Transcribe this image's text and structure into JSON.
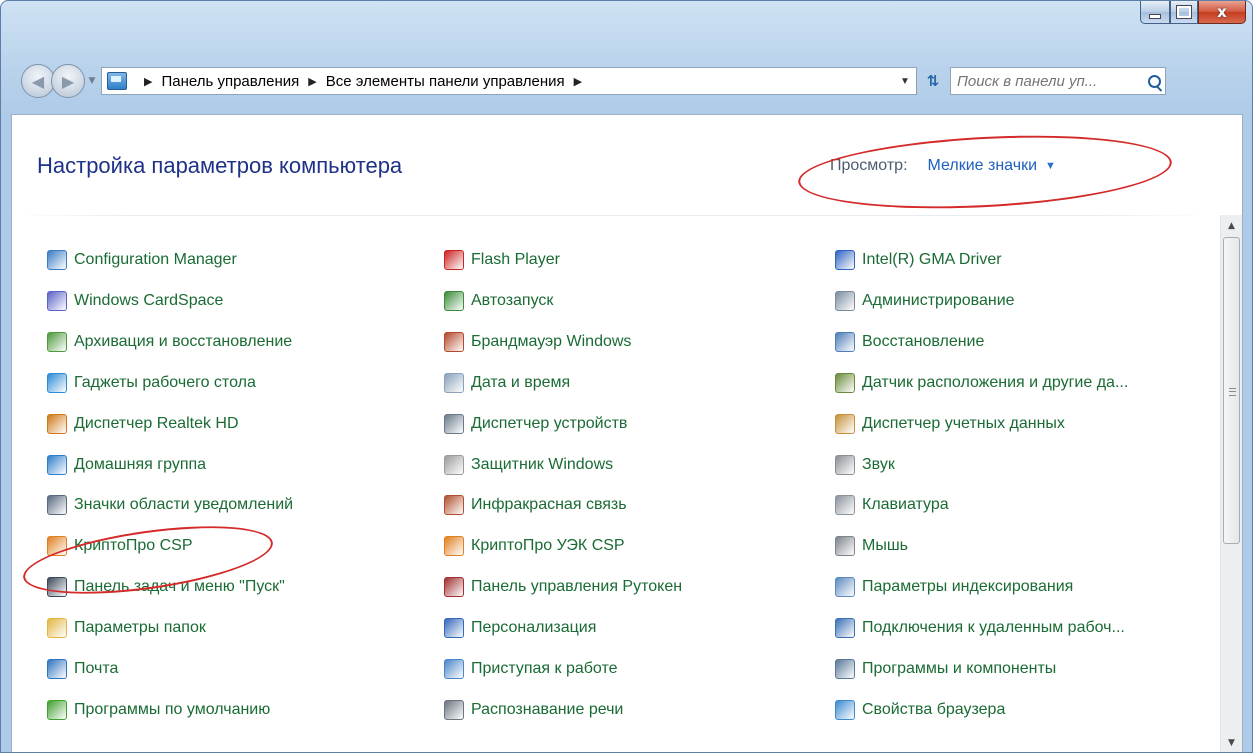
{
  "window": {
    "minimize_label": "",
    "maximize_label": "",
    "close_label": "x"
  },
  "nav": {
    "back_icon": "back-arrow-icon",
    "forward_icon": "forward-arrow-icon",
    "breadcrumb": [
      "Панель управления",
      "Все элементы панели управления"
    ],
    "search_placeholder": "Поиск в панели уп..."
  },
  "main": {
    "heading": "Настройка параметров компьютера",
    "view_label": "Просмотр:",
    "view_value": "Мелкие значки"
  },
  "items": [
    [
      {
        "label": "Configuration Manager",
        "icon": "configuration-manager-icon",
        "color": "#3a7dc4"
      },
      {
        "label": "Windows CardSpace",
        "icon": "cardspace-icon",
        "color": "#5a62c8"
      },
      {
        "label": "Архивация и восстановление",
        "icon": "backup-icon",
        "color": "#4f9a3d"
      },
      {
        "label": "Гаджеты рабочего стола",
        "icon": "gadgets-icon",
        "color": "#2b8bd6"
      },
      {
        "label": "Диспетчер Realtek HD",
        "icon": "realtek-icon",
        "color": "#d07a18"
      },
      {
        "label": "Домашняя группа",
        "icon": "homegroup-icon",
        "color": "#2e7ecb"
      },
      {
        "label": "Значки области уведомлений",
        "icon": "notification-icons-icon",
        "color": "#586a80"
      },
      {
        "label": "КриптоПро CSP",
        "icon": "cryptopro-icon",
        "color": "#e08020"
      },
      {
        "label": "Панель задач и меню \"Пуск\"",
        "icon": "taskbar-icon",
        "color": "#3d4a5c"
      },
      {
        "label": "Параметры папок",
        "icon": "folder-options-icon",
        "color": "#e2b640"
      },
      {
        "label": "Почта",
        "icon": "mail-icon",
        "color": "#2f74c0"
      },
      {
        "label": "Программы по умолчанию",
        "icon": "default-programs-icon",
        "color": "#41a02f"
      }
    ],
    [
      {
        "label": "Flash Player",
        "icon": "flash-player-icon",
        "color": "#cc2222"
      },
      {
        "label": "Автозапуск",
        "icon": "autoplay-icon",
        "color": "#3a8a3a"
      },
      {
        "label": "Брандмауэр Windows",
        "icon": "firewall-icon",
        "color": "#b24a2a"
      },
      {
        "label": "Дата и время",
        "icon": "clock-icon",
        "color": "#8aa0bb"
      },
      {
        "label": "Диспетчер устройств",
        "icon": "device-manager-icon",
        "color": "#6a7a8c"
      },
      {
        "label": "Защитник Windows",
        "icon": "defender-icon",
        "color": "#9b9b9b"
      },
      {
        "label": "Инфракрасная связь",
        "icon": "infrared-icon",
        "color": "#b05030"
      },
      {
        "label": "КриптоПро УЭК CSP",
        "icon": "cryptopro-uek-icon",
        "color": "#e08020"
      },
      {
        "label": "Панель управления Рутокен",
        "icon": "rutoken-icon",
        "color": "#a03030"
      },
      {
        "label": "Персонализация",
        "icon": "personalization-icon",
        "color": "#3468b8"
      },
      {
        "label": "Приступая к работе",
        "icon": "getting-started-icon",
        "color": "#4a86c8"
      },
      {
        "label": "Распознавание речи",
        "icon": "microphone-icon",
        "color": "#6b7480"
      }
    ],
    [
      {
        "label": "Intel(R) GMA Driver",
        "icon": "intel-gma-icon",
        "color": "#2f63c2"
      },
      {
        "label": "Администрирование",
        "icon": "administration-icon",
        "color": "#7a8c9e"
      },
      {
        "label": "Восстановление",
        "icon": "recovery-icon",
        "color": "#4c7db8"
      },
      {
        "label": "Датчик расположения и другие да...",
        "icon": "location-sensor-icon",
        "color": "#6b8b3a"
      },
      {
        "label": "Диспетчер учетных данных",
        "icon": "credential-manager-icon",
        "color": "#c6913a"
      },
      {
        "label": "Звук",
        "icon": "speaker-icon",
        "color": "#8a8f96"
      },
      {
        "label": "Клавиатура",
        "icon": "keyboard-icon",
        "color": "#8b929b"
      },
      {
        "label": "Мышь",
        "icon": "mouse-icon",
        "color": "#7d848c"
      },
      {
        "label": "Параметры индексирования",
        "icon": "indexing-icon",
        "color": "#5c8ac0"
      },
      {
        "label": "Подключения к удаленным рабоч...",
        "icon": "remote-desktop-icon",
        "color": "#3b6fb6"
      },
      {
        "label": "Программы и компоненты",
        "icon": "programs-icon",
        "color": "#5a7898"
      },
      {
        "label": "Свойства браузера",
        "icon": "internet-options-icon",
        "color": "#3a8ad0"
      }
    ]
  ],
  "colors": {
    "link": "#1a6b34",
    "heading": "#1e3287",
    "highlight_ellipse": "#d42a2a"
  }
}
